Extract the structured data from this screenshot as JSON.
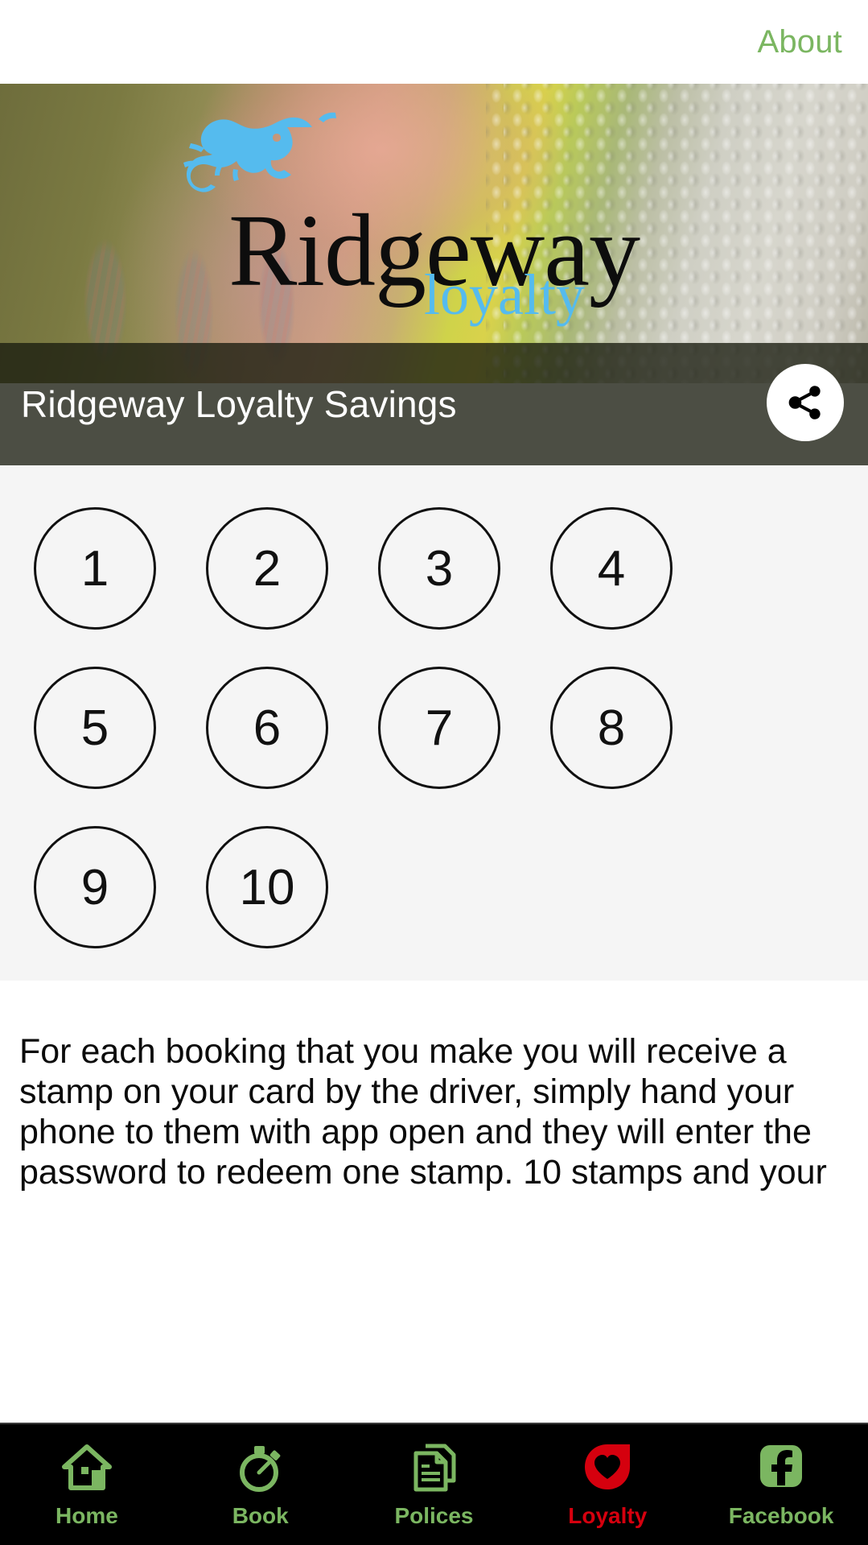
{
  "header": {
    "about_label": "About"
  },
  "hero": {
    "brand_name": "Ridgeway",
    "brand_sub": "loyalty",
    "logo_icon": "gecko-icon"
  },
  "titlebar": {
    "title": "Ridgeway Loyalty Savings",
    "share_icon": "share-icon"
  },
  "stamps": {
    "rows": [
      [
        "1",
        "2",
        "3",
        "4"
      ],
      [
        "5",
        "6",
        "7",
        "8"
      ],
      [
        "9",
        "10"
      ]
    ]
  },
  "info": {
    "paragraph": "For each booking that you make you will receive a stamp on your card by the driver, simply hand your phone to them with app open and they will enter the password to redeem one stamp. 10 stamps and your"
  },
  "tabbar": {
    "items": [
      {
        "label": "Home",
        "icon": "home-icon",
        "active": false
      },
      {
        "label": "Book",
        "icon": "stopwatch-icon",
        "active": false
      },
      {
        "label": "Polices",
        "icon": "documents-icon",
        "active": false
      },
      {
        "label": "Loyalty",
        "icon": "heart-pin-icon",
        "active": true
      },
      {
        "label": "Facebook",
        "icon": "facebook-icon",
        "active": false
      }
    ]
  },
  "colors": {
    "accent_green": "#7bb661",
    "active_red": "#d5000e",
    "panel_bg": "#f5f5f5",
    "tabbar_bg": "#000000",
    "logo_blue": "#55bbee"
  }
}
